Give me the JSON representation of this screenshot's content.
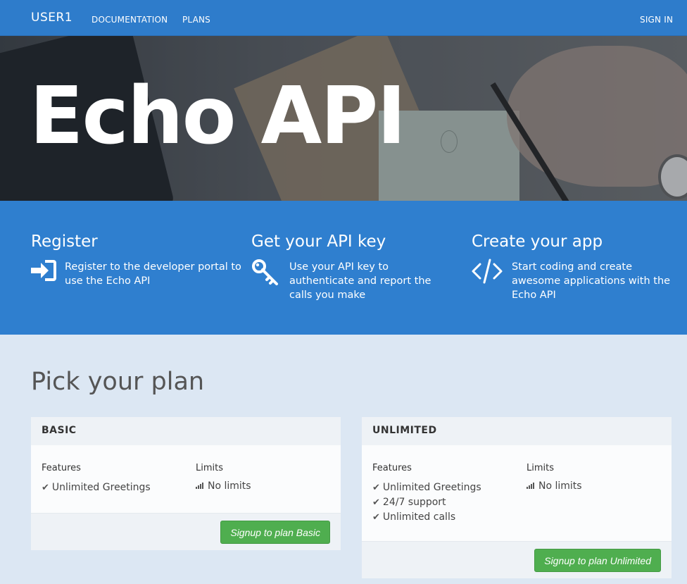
{
  "nav": {
    "brand": "USER1",
    "links": [
      "DOCUMENTATION",
      "PLANS"
    ],
    "sign_in": "SIGN IN"
  },
  "hero": {
    "title": "Echo API"
  },
  "features": [
    {
      "title": "Register",
      "text": "Register to the developer portal to use the Echo API",
      "icon": "sign-in-icon"
    },
    {
      "title": "Get your API key",
      "text": "Use your API key to authenticate and report the calls you make",
      "icon": "key-icon"
    },
    {
      "title": "Create your app",
      "text": "Start coding and create awesome applications with the Echo API",
      "icon": "code-icon"
    }
  ],
  "plans_title": "Pick your plan",
  "plans": [
    {
      "name": "BASIC",
      "features_label": "Features",
      "limits_label": "Limits",
      "features": [
        "Unlimited Greetings"
      ],
      "limit": "No limits",
      "button": "Signup to plan Basic"
    },
    {
      "name": "UNLIMITED",
      "features_label": "Features",
      "limits_label": "Limits",
      "features": [
        "Unlimited Greetings",
        "24/7 support",
        "Unlimited calls"
      ],
      "limit": "No limits",
      "button": "Signup to plan Unlimited"
    }
  ],
  "colors": {
    "primary": "#2f7fcf",
    "success": "#4fae4f",
    "background": "#dce7f3"
  }
}
